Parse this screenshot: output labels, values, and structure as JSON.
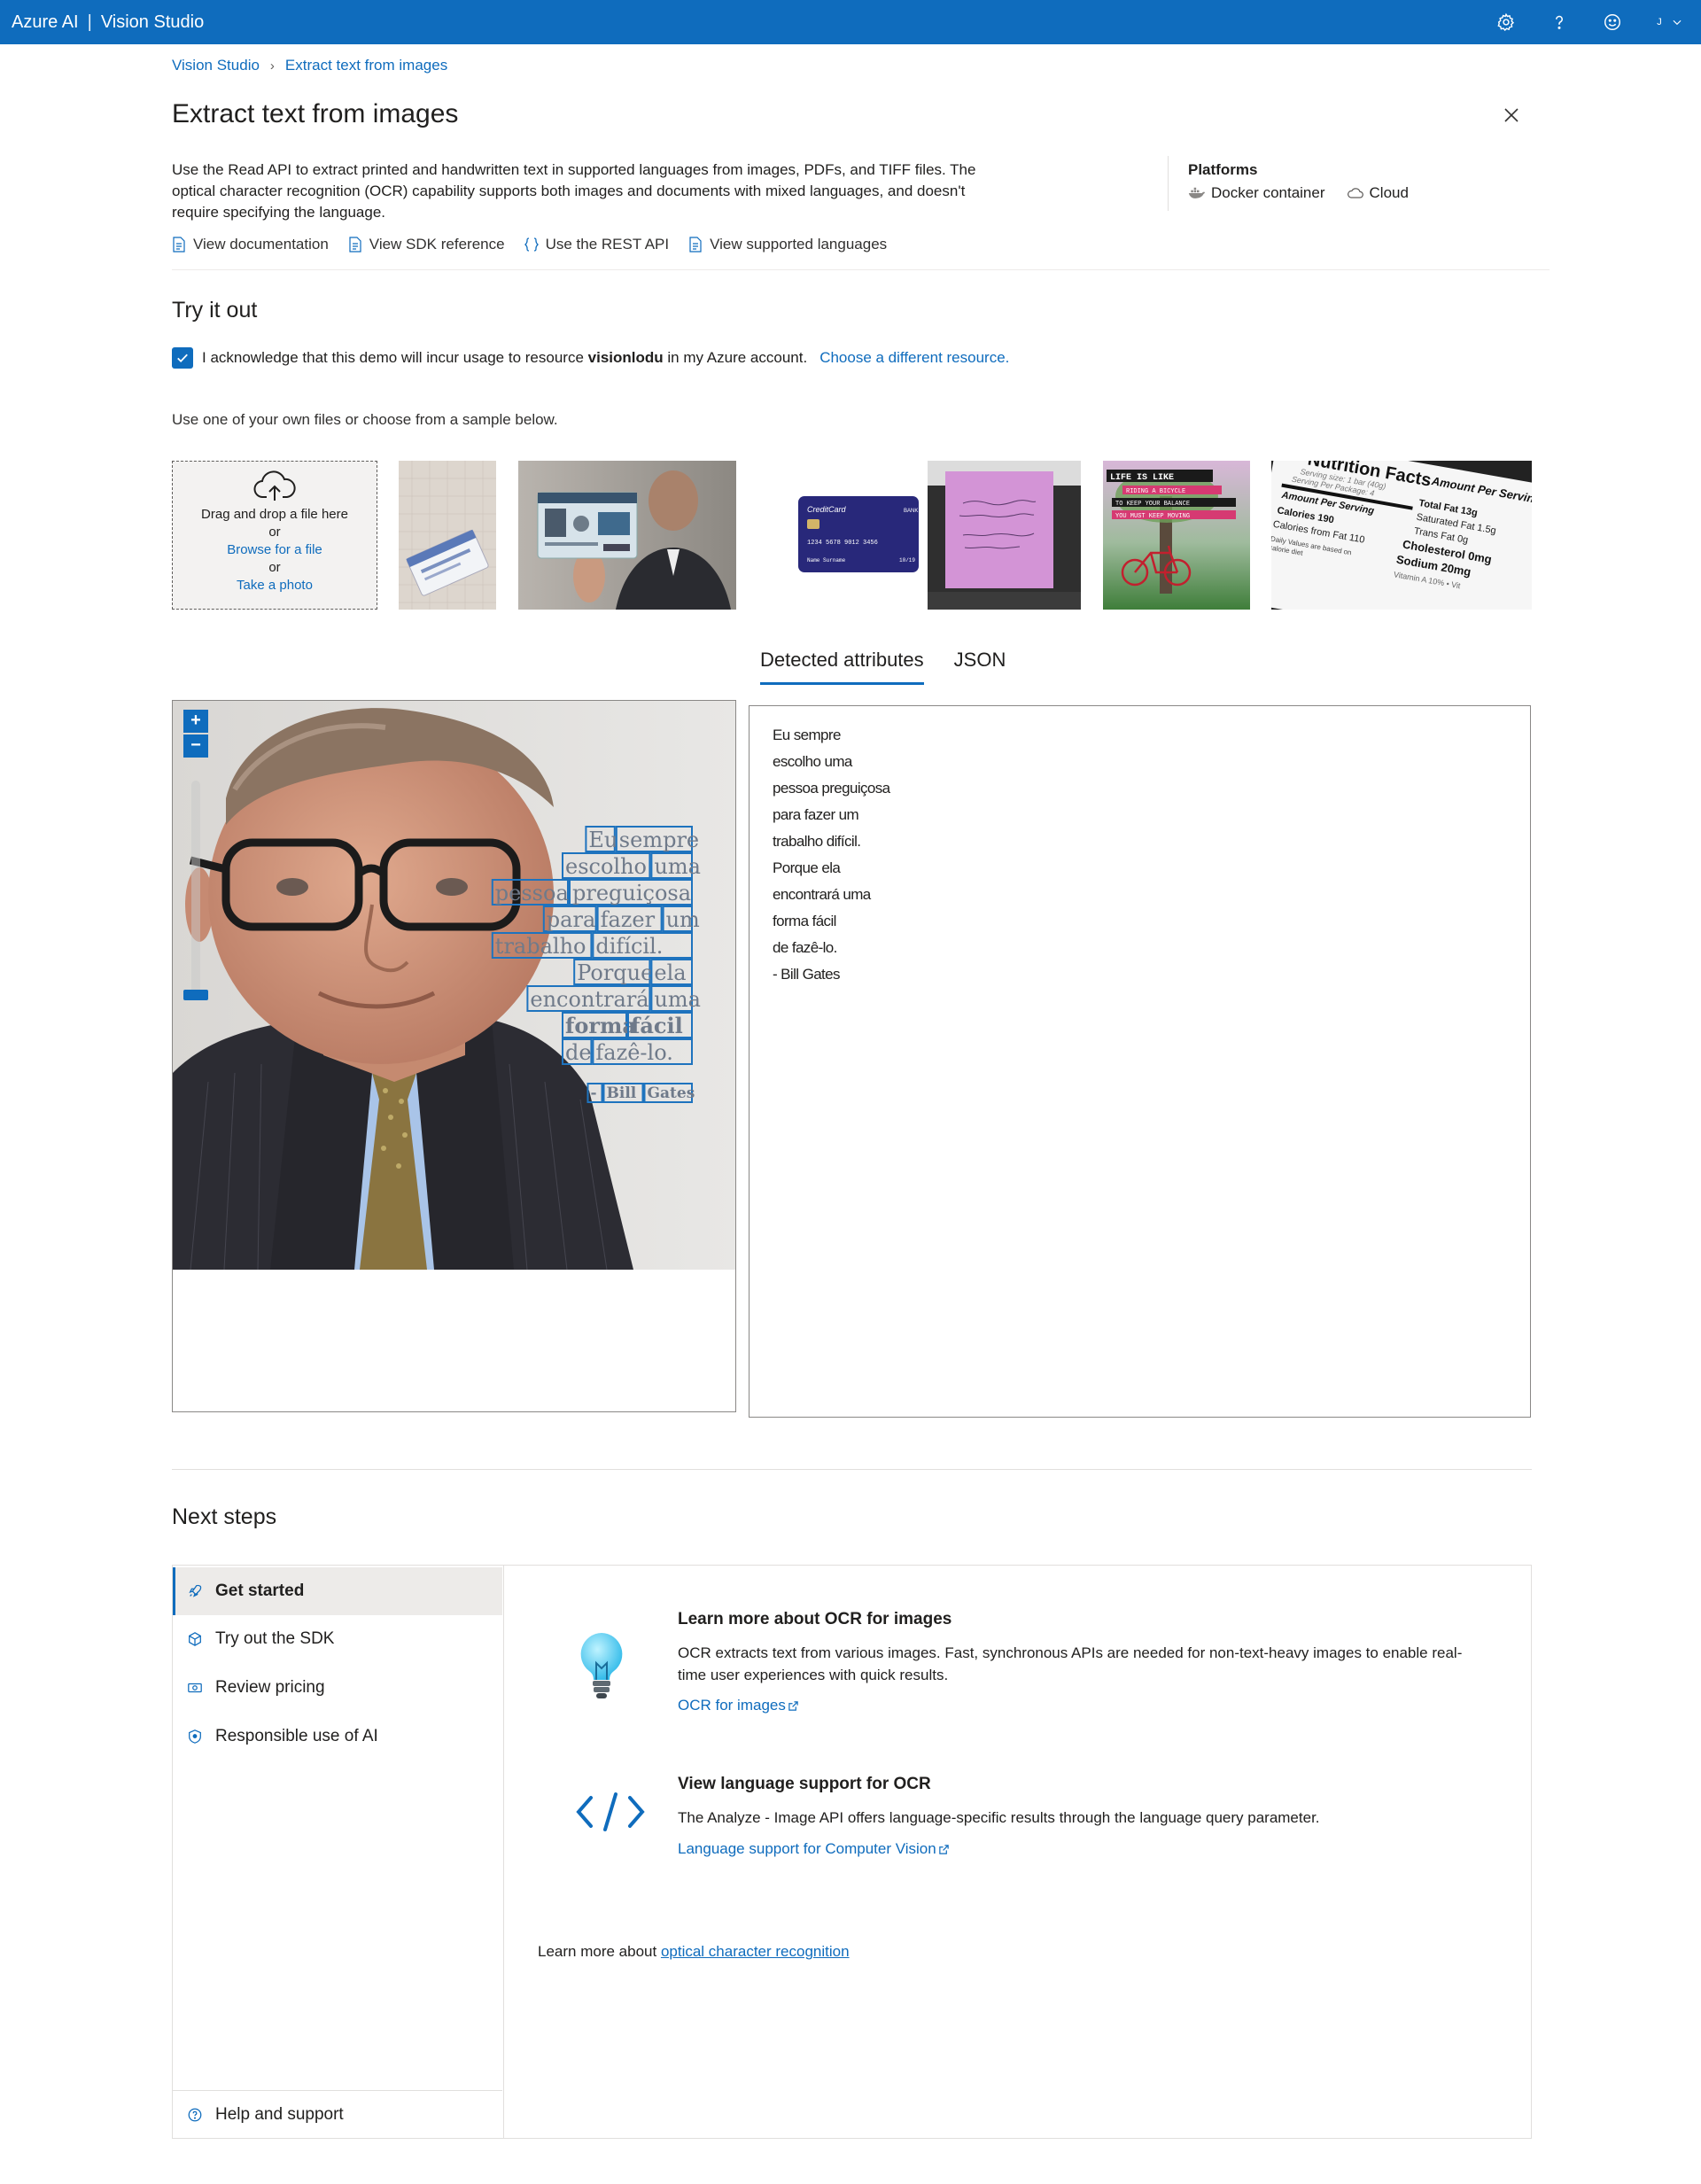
{
  "topbar": {
    "brand": "Azure AI",
    "product": "Vision Studio",
    "account_initial": "J"
  },
  "breadcrumb": {
    "root": "Vision Studio",
    "current": "Extract text from images"
  },
  "page": {
    "title": "Extract text from images",
    "description": "Use the Read API to extract printed and handwritten text in supported languages from images, PDFs, and TIFF files. The optical character recognition (OCR) capability supports both images and documents with mixed languages, and doesn't require specifying the language.",
    "links": {
      "documentation": "View documentation",
      "sdk": "View SDK reference",
      "rest": "Use the REST API",
      "languages": "View supported languages"
    },
    "platforms": {
      "title": "Platforms",
      "docker": "Docker container",
      "cloud": "Cloud"
    }
  },
  "try_it": {
    "title": "Try it out",
    "ack_prefix": "I acknowledge that this demo will incur usage to resource",
    "resource": "visionlodu",
    "ack_suffix": "in my Azure account.",
    "choose_resource": "Choose a different resource.",
    "hint": "Use one of your own files or choose from a sample below.",
    "upload": {
      "drag": "Drag and drop a file here",
      "or1": "or",
      "browse": "Browse for a file",
      "or2": "or",
      "photo": "Take a photo"
    },
    "samples": {
      "credit_card": {
        "brand": "CreditCard",
        "bank": "BANK",
        "number": "1234 5678 9012 3456",
        "name": "Name Surname",
        "expiry": "10/19"
      },
      "poster": {
        "line1": "LIFE IS LIKE",
        "line2": "RIDING A BICYCLE",
        "line3": "TO KEEP YOUR BALANCE",
        "line4": "YOU MUST KEEP MOVING"
      },
      "nutrition": {
        "title": "Nutrition Facts",
        "serving1": "Serving size: 1 bar (40g)",
        "serving2": "Serving Per Package: 4",
        "amount": "Amount Per Serving",
        "calories": "Calories 190",
        "fat_cal": "Calories from Fat 110",
        "daily": "Daily Values are based on",
        "daily2": "calorie diet",
        "total_fat": "Total Fat 13g",
        "sat_fat": "Saturated Fat 1.5g",
        "trans_fat": "Trans Fat 0g",
        "cholesterol": "Cholesterol 0mg",
        "sodium": "Sodium 20mg",
        "vitamin": "Vitamin A 10% • Vit"
      }
    }
  },
  "result_tabs": {
    "attributes": "Detected attributes",
    "json": "JSON"
  },
  "viewer": {
    "zoom_in": "+",
    "zoom_out": "−",
    "overlay_words": [
      [
        "Eu",
        "sempre"
      ],
      [
        "escolho",
        "uma"
      ],
      [
        "pessoa",
        "preguiçosa"
      ],
      [
        "para",
        "fazer",
        "um"
      ],
      [
        "trabalho",
        "difícil."
      ],
      [
        "Porque",
        "ela"
      ],
      [
        "encontrará",
        "uma"
      ],
      [
        "forma",
        "fácil"
      ],
      [
        "de",
        "fazê-lo."
      ],
      [
        "-",
        "Bill",
        "Gates"
      ]
    ]
  },
  "detected_lines": [
    "Eu sempre",
    "escolho uma",
    "pessoa preguiçosa",
    "para fazer um",
    "trabalho difícil.",
    "Porque ela",
    "encontrará uma",
    "forma fácil",
    "de fazê-lo.",
    "- Bill Gates"
  ],
  "next_steps": {
    "title": "Next steps",
    "nav": {
      "get_started": "Get started",
      "sdk": "Try out the SDK",
      "pricing": "Review pricing",
      "responsible": "Responsible use of AI",
      "help": "Help and support"
    },
    "card1": {
      "title": "Learn more about OCR for images",
      "body": "OCR extracts text from various images. Fast, synchronous APIs are needed for non-text-heavy images to enable real-time user experiences with quick results.",
      "link": "OCR for images"
    },
    "card2": {
      "title": "View language support for OCR",
      "body": "The Analyze - Image API offers language-specific results through the language query parameter.",
      "link": "Language support for Computer Vision"
    },
    "learn_more_prefix": "Learn more about",
    "learn_more_link": "optical character recognition"
  },
  "colors": {
    "accent": "#0f6cbd",
    "topbar": "#0f6cbd",
    "overlay_box": "#1e73be"
  }
}
